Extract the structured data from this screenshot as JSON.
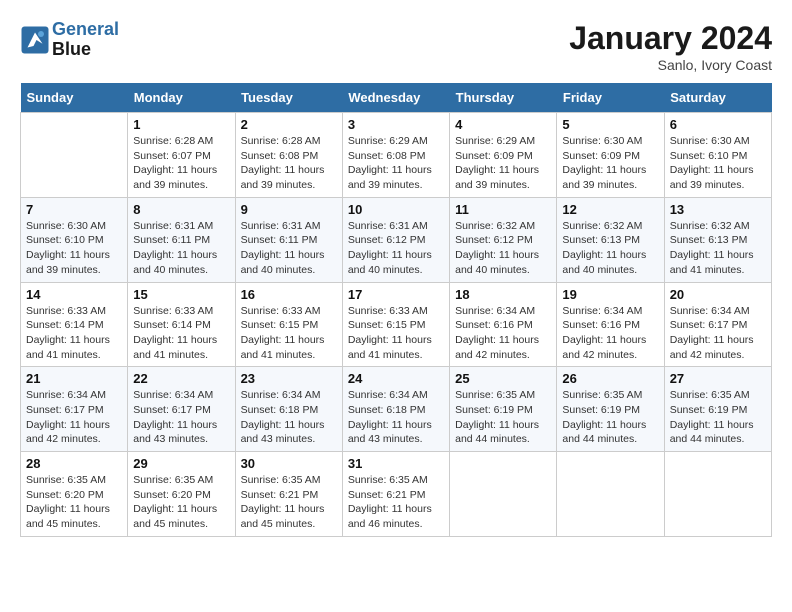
{
  "header": {
    "logo_line1": "General",
    "logo_line2": "Blue",
    "title": "January 2024",
    "subtitle": "Sanlo, Ivory Coast"
  },
  "columns": [
    "Sunday",
    "Monday",
    "Tuesday",
    "Wednesday",
    "Thursday",
    "Friday",
    "Saturday"
  ],
  "weeks": [
    [
      {
        "day": "",
        "info": ""
      },
      {
        "day": "1",
        "info": "Sunrise: 6:28 AM\nSunset: 6:07 PM\nDaylight: 11 hours and 39 minutes."
      },
      {
        "day": "2",
        "info": "Sunrise: 6:28 AM\nSunset: 6:08 PM\nDaylight: 11 hours and 39 minutes."
      },
      {
        "day": "3",
        "info": "Sunrise: 6:29 AM\nSunset: 6:08 PM\nDaylight: 11 hours and 39 minutes."
      },
      {
        "day": "4",
        "info": "Sunrise: 6:29 AM\nSunset: 6:09 PM\nDaylight: 11 hours and 39 minutes."
      },
      {
        "day": "5",
        "info": "Sunrise: 6:30 AM\nSunset: 6:09 PM\nDaylight: 11 hours and 39 minutes."
      },
      {
        "day": "6",
        "info": "Sunrise: 6:30 AM\nSunset: 6:10 PM\nDaylight: 11 hours and 39 minutes."
      }
    ],
    [
      {
        "day": "7",
        "info": "Sunrise: 6:30 AM\nSunset: 6:10 PM\nDaylight: 11 hours and 39 minutes."
      },
      {
        "day": "8",
        "info": "Sunrise: 6:31 AM\nSunset: 6:11 PM\nDaylight: 11 hours and 40 minutes."
      },
      {
        "day": "9",
        "info": "Sunrise: 6:31 AM\nSunset: 6:11 PM\nDaylight: 11 hours and 40 minutes."
      },
      {
        "day": "10",
        "info": "Sunrise: 6:31 AM\nSunset: 6:12 PM\nDaylight: 11 hours and 40 minutes."
      },
      {
        "day": "11",
        "info": "Sunrise: 6:32 AM\nSunset: 6:12 PM\nDaylight: 11 hours and 40 minutes."
      },
      {
        "day": "12",
        "info": "Sunrise: 6:32 AM\nSunset: 6:13 PM\nDaylight: 11 hours and 40 minutes."
      },
      {
        "day": "13",
        "info": "Sunrise: 6:32 AM\nSunset: 6:13 PM\nDaylight: 11 hours and 41 minutes."
      }
    ],
    [
      {
        "day": "14",
        "info": "Sunrise: 6:33 AM\nSunset: 6:14 PM\nDaylight: 11 hours and 41 minutes."
      },
      {
        "day": "15",
        "info": "Sunrise: 6:33 AM\nSunset: 6:14 PM\nDaylight: 11 hours and 41 minutes."
      },
      {
        "day": "16",
        "info": "Sunrise: 6:33 AM\nSunset: 6:15 PM\nDaylight: 11 hours and 41 minutes."
      },
      {
        "day": "17",
        "info": "Sunrise: 6:33 AM\nSunset: 6:15 PM\nDaylight: 11 hours and 41 minutes."
      },
      {
        "day": "18",
        "info": "Sunrise: 6:34 AM\nSunset: 6:16 PM\nDaylight: 11 hours and 42 minutes."
      },
      {
        "day": "19",
        "info": "Sunrise: 6:34 AM\nSunset: 6:16 PM\nDaylight: 11 hours and 42 minutes."
      },
      {
        "day": "20",
        "info": "Sunrise: 6:34 AM\nSunset: 6:17 PM\nDaylight: 11 hours and 42 minutes."
      }
    ],
    [
      {
        "day": "21",
        "info": "Sunrise: 6:34 AM\nSunset: 6:17 PM\nDaylight: 11 hours and 42 minutes."
      },
      {
        "day": "22",
        "info": "Sunrise: 6:34 AM\nSunset: 6:17 PM\nDaylight: 11 hours and 43 minutes."
      },
      {
        "day": "23",
        "info": "Sunrise: 6:34 AM\nSunset: 6:18 PM\nDaylight: 11 hours and 43 minutes."
      },
      {
        "day": "24",
        "info": "Sunrise: 6:34 AM\nSunset: 6:18 PM\nDaylight: 11 hours and 43 minutes."
      },
      {
        "day": "25",
        "info": "Sunrise: 6:35 AM\nSunset: 6:19 PM\nDaylight: 11 hours and 44 minutes."
      },
      {
        "day": "26",
        "info": "Sunrise: 6:35 AM\nSunset: 6:19 PM\nDaylight: 11 hours and 44 minutes."
      },
      {
        "day": "27",
        "info": "Sunrise: 6:35 AM\nSunset: 6:19 PM\nDaylight: 11 hours and 44 minutes."
      }
    ],
    [
      {
        "day": "28",
        "info": "Sunrise: 6:35 AM\nSunset: 6:20 PM\nDaylight: 11 hours and 45 minutes."
      },
      {
        "day": "29",
        "info": "Sunrise: 6:35 AM\nSunset: 6:20 PM\nDaylight: 11 hours and 45 minutes."
      },
      {
        "day": "30",
        "info": "Sunrise: 6:35 AM\nSunset: 6:21 PM\nDaylight: 11 hours and 45 minutes."
      },
      {
        "day": "31",
        "info": "Sunrise: 6:35 AM\nSunset: 6:21 PM\nDaylight: 11 hours and 46 minutes."
      },
      {
        "day": "",
        "info": ""
      },
      {
        "day": "",
        "info": ""
      },
      {
        "day": "",
        "info": ""
      }
    ]
  ]
}
